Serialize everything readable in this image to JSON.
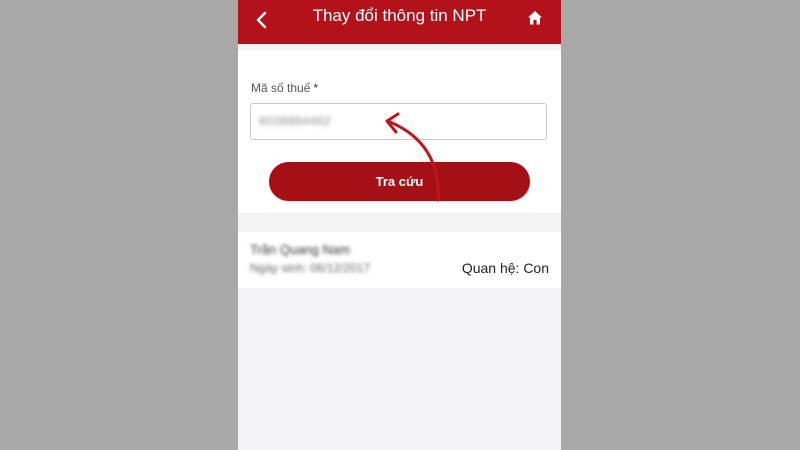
{
  "header": {
    "title": "Thay đổi thông tin NPT",
    "back_icon": "chevron-left-icon",
    "home_icon": "home-icon",
    "bg_color": "#b4121a"
  },
  "form": {
    "tax_label": "Mã số thuế",
    "required_mark": "*",
    "tax_value": "8039884492",
    "search_button": "Tra cứu",
    "button_color": "#a50f16"
  },
  "dependent": {
    "name": "Trần Quang Nam",
    "dob": "Ngày sinh: 06/12/2017",
    "relation": "Quan hệ: Con"
  },
  "annotation": {
    "arrow_icon": "curved-arrow-icon",
    "arrow_color": "#c0141c"
  }
}
